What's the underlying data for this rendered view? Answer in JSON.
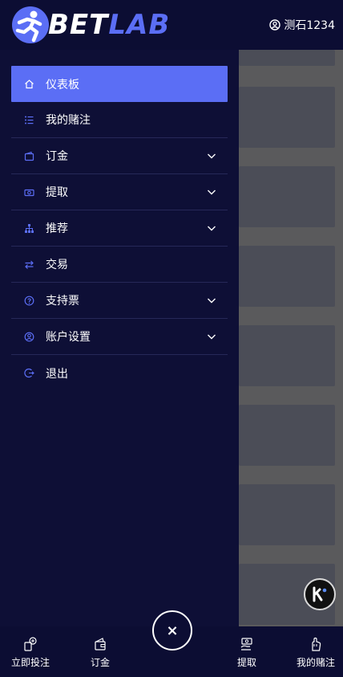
{
  "header": {
    "logo_bet": "BET",
    "logo_lab": "LAB",
    "username": "测石1234"
  },
  "menu": {
    "items": [
      {
        "label": "仪表板",
        "icon": "home-icon",
        "active": true,
        "expandable": false
      },
      {
        "label": "我的赌注",
        "icon": "list-icon",
        "active": false,
        "expandable": false
      },
      {
        "label": "订金",
        "icon": "wallet-icon",
        "active": false,
        "expandable": true
      },
      {
        "label": "提取",
        "icon": "money-icon",
        "active": false,
        "expandable": true
      },
      {
        "label": "推荐",
        "icon": "network-icon",
        "active": false,
        "expandable": true
      },
      {
        "label": "交易",
        "icon": "exchange-icon",
        "active": false,
        "expandable": false
      },
      {
        "label": "支持票",
        "icon": "help-icon",
        "active": false,
        "expandable": true
      },
      {
        "label": "账户设置",
        "icon": "account-icon",
        "active": false,
        "expandable": true
      },
      {
        "label": "退出",
        "icon": "logout-icon",
        "active": false,
        "expandable": false
      }
    ]
  },
  "bottom_nav": {
    "place_bet": "立即投注",
    "deposit": "订金",
    "close": "×",
    "withdraw": "提取",
    "my_bets": "我的赌注"
  },
  "colors": {
    "accent": "#5b6ef5",
    "background": "#0c0d33",
    "drawer": "#0e0f36",
    "overlay": "#5a5a5c"
  }
}
